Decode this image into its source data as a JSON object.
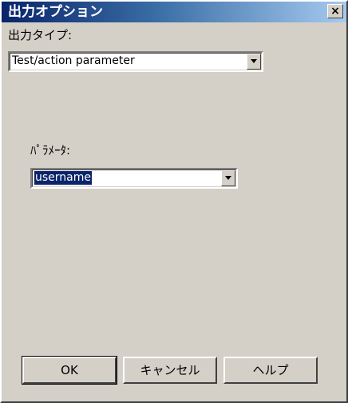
{
  "window": {
    "title": "出力オプション",
    "close_glyph": "×"
  },
  "output_type": {
    "label": "出力タイプ:",
    "value": "Test/action parameter"
  },
  "parameter": {
    "label": "ﾊﾟﾗﾒｰﾀ:",
    "value": "username"
  },
  "buttons": {
    "ok": "OK",
    "cancel": "キャンセル",
    "help": "ヘルプ"
  },
  "colors": {
    "titlebar_start": "#0a246a",
    "titlebar_end": "#a6caf0",
    "face": "#d4d0c8",
    "selection": "#0a246a"
  }
}
